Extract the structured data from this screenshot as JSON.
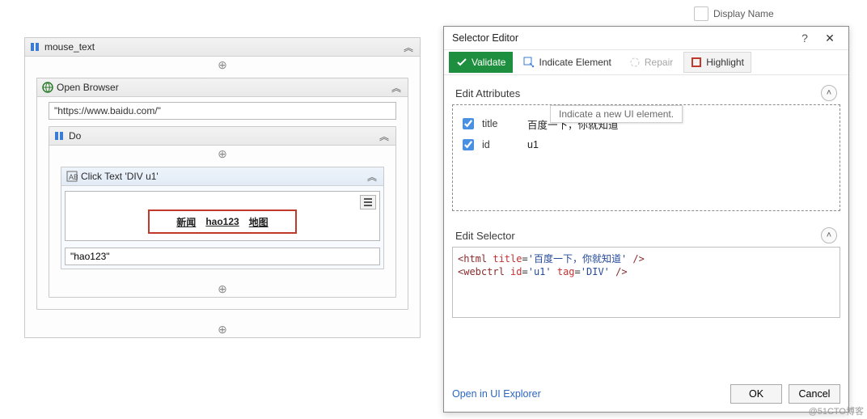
{
  "property_panel": {
    "display_name_label": "Display Name"
  },
  "sequence": {
    "title": "mouse_text",
    "open_browser": {
      "title": "Open Browser",
      "url": "\"https://www.baidu.com/\""
    },
    "do_block": {
      "title": "Do"
    },
    "click_text": {
      "title": "Click Text 'DIV  u1'",
      "preview_items": [
        "新闻",
        "hao123",
        "地图"
      ],
      "keyword": "\"hao123\""
    }
  },
  "dialog": {
    "title": "Selector Editor",
    "toolbar": {
      "validate": "Validate",
      "indicate": "Indicate Element",
      "repair": "Repair",
      "highlight": "Highlight",
      "tooltip": "Indicate a new UI element."
    },
    "attributes": {
      "heading": "Edit Attributes",
      "rows": [
        {
          "checked": true,
          "name": "title",
          "value": "百度一下，你就知道"
        },
        {
          "checked": true,
          "name": "id",
          "value": "u1"
        }
      ]
    },
    "selector": {
      "heading": "Edit Selector",
      "lines": [
        {
          "tag": "html",
          "attrs": [
            {
              "k": "title",
              "v": "百度一下，你就知道"
            }
          ]
        },
        {
          "tag": "webctrl",
          "attrs": [
            {
              "k": "id",
              "v": "u1"
            },
            {
              "k": "tag",
              "v": "DIV"
            }
          ]
        }
      ],
      "raw": "<html title='百度一下，你就知道' />\n<webctrl id='u1' tag='DIV' />"
    },
    "open_explorer": "Open in UI Explorer",
    "ok": "OK",
    "cancel": "Cancel"
  },
  "watermark": "@51CTO博客"
}
